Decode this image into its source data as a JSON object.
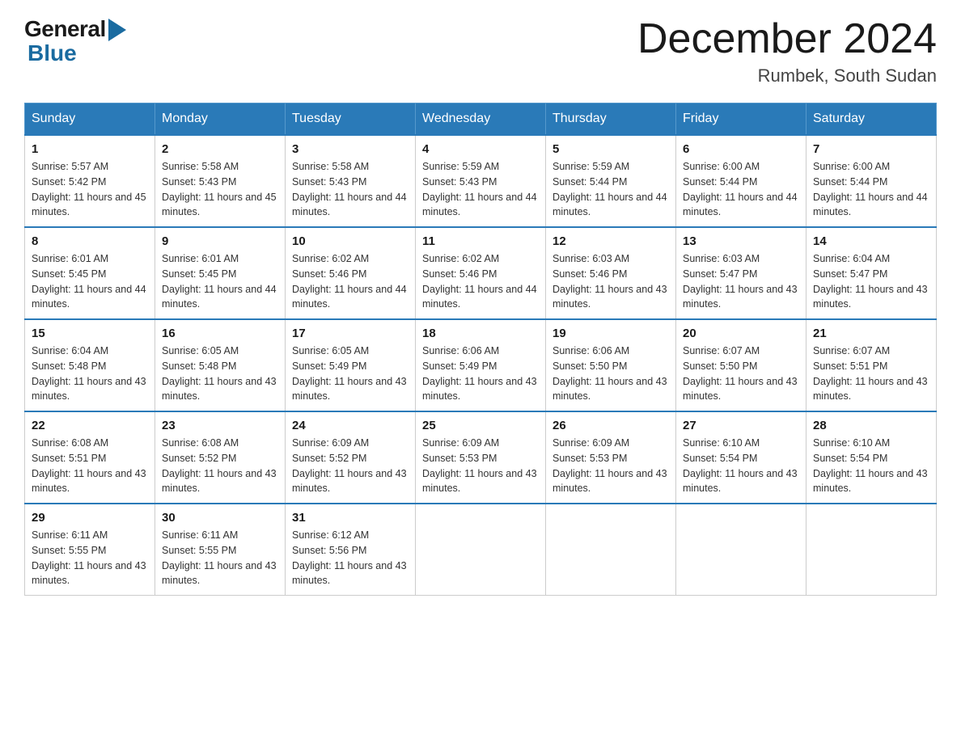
{
  "header": {
    "logo": {
      "general": "General",
      "blue": "Blue"
    },
    "title": "December 2024",
    "location": "Rumbek, South Sudan"
  },
  "weekdays": [
    "Sunday",
    "Monday",
    "Tuesday",
    "Wednesday",
    "Thursday",
    "Friday",
    "Saturday"
  ],
  "weeks": [
    [
      {
        "day": "1",
        "sunrise": "5:57 AM",
        "sunset": "5:42 PM",
        "daylight": "11 hours and 45 minutes."
      },
      {
        "day": "2",
        "sunrise": "5:58 AM",
        "sunset": "5:43 PM",
        "daylight": "11 hours and 45 minutes."
      },
      {
        "day": "3",
        "sunrise": "5:58 AM",
        "sunset": "5:43 PM",
        "daylight": "11 hours and 44 minutes."
      },
      {
        "day": "4",
        "sunrise": "5:59 AM",
        "sunset": "5:43 PM",
        "daylight": "11 hours and 44 minutes."
      },
      {
        "day": "5",
        "sunrise": "5:59 AM",
        "sunset": "5:44 PM",
        "daylight": "11 hours and 44 minutes."
      },
      {
        "day": "6",
        "sunrise": "6:00 AM",
        "sunset": "5:44 PM",
        "daylight": "11 hours and 44 minutes."
      },
      {
        "day": "7",
        "sunrise": "6:00 AM",
        "sunset": "5:44 PM",
        "daylight": "11 hours and 44 minutes."
      }
    ],
    [
      {
        "day": "8",
        "sunrise": "6:01 AM",
        "sunset": "5:45 PM",
        "daylight": "11 hours and 44 minutes."
      },
      {
        "day": "9",
        "sunrise": "6:01 AM",
        "sunset": "5:45 PM",
        "daylight": "11 hours and 44 minutes."
      },
      {
        "day": "10",
        "sunrise": "6:02 AM",
        "sunset": "5:46 PM",
        "daylight": "11 hours and 44 minutes."
      },
      {
        "day": "11",
        "sunrise": "6:02 AM",
        "sunset": "5:46 PM",
        "daylight": "11 hours and 44 minutes."
      },
      {
        "day": "12",
        "sunrise": "6:03 AM",
        "sunset": "5:46 PM",
        "daylight": "11 hours and 43 minutes."
      },
      {
        "day": "13",
        "sunrise": "6:03 AM",
        "sunset": "5:47 PM",
        "daylight": "11 hours and 43 minutes."
      },
      {
        "day": "14",
        "sunrise": "6:04 AM",
        "sunset": "5:47 PM",
        "daylight": "11 hours and 43 minutes."
      }
    ],
    [
      {
        "day": "15",
        "sunrise": "6:04 AM",
        "sunset": "5:48 PM",
        "daylight": "11 hours and 43 minutes."
      },
      {
        "day": "16",
        "sunrise": "6:05 AM",
        "sunset": "5:48 PM",
        "daylight": "11 hours and 43 minutes."
      },
      {
        "day": "17",
        "sunrise": "6:05 AM",
        "sunset": "5:49 PM",
        "daylight": "11 hours and 43 minutes."
      },
      {
        "day": "18",
        "sunrise": "6:06 AM",
        "sunset": "5:49 PM",
        "daylight": "11 hours and 43 minutes."
      },
      {
        "day": "19",
        "sunrise": "6:06 AM",
        "sunset": "5:50 PM",
        "daylight": "11 hours and 43 minutes."
      },
      {
        "day": "20",
        "sunrise": "6:07 AM",
        "sunset": "5:50 PM",
        "daylight": "11 hours and 43 minutes."
      },
      {
        "day": "21",
        "sunrise": "6:07 AM",
        "sunset": "5:51 PM",
        "daylight": "11 hours and 43 minutes."
      }
    ],
    [
      {
        "day": "22",
        "sunrise": "6:08 AM",
        "sunset": "5:51 PM",
        "daylight": "11 hours and 43 minutes."
      },
      {
        "day": "23",
        "sunrise": "6:08 AM",
        "sunset": "5:52 PM",
        "daylight": "11 hours and 43 minutes."
      },
      {
        "day": "24",
        "sunrise": "6:09 AM",
        "sunset": "5:52 PM",
        "daylight": "11 hours and 43 minutes."
      },
      {
        "day": "25",
        "sunrise": "6:09 AM",
        "sunset": "5:53 PM",
        "daylight": "11 hours and 43 minutes."
      },
      {
        "day": "26",
        "sunrise": "6:09 AM",
        "sunset": "5:53 PM",
        "daylight": "11 hours and 43 minutes."
      },
      {
        "day": "27",
        "sunrise": "6:10 AM",
        "sunset": "5:54 PM",
        "daylight": "11 hours and 43 minutes."
      },
      {
        "day": "28",
        "sunrise": "6:10 AM",
        "sunset": "5:54 PM",
        "daylight": "11 hours and 43 minutes."
      }
    ],
    [
      {
        "day": "29",
        "sunrise": "6:11 AM",
        "sunset": "5:55 PM",
        "daylight": "11 hours and 43 minutes."
      },
      {
        "day": "30",
        "sunrise": "6:11 AM",
        "sunset": "5:55 PM",
        "daylight": "11 hours and 43 minutes."
      },
      {
        "day": "31",
        "sunrise": "6:12 AM",
        "sunset": "5:56 PM",
        "daylight": "11 hours and 43 minutes."
      },
      null,
      null,
      null,
      null
    ]
  ]
}
